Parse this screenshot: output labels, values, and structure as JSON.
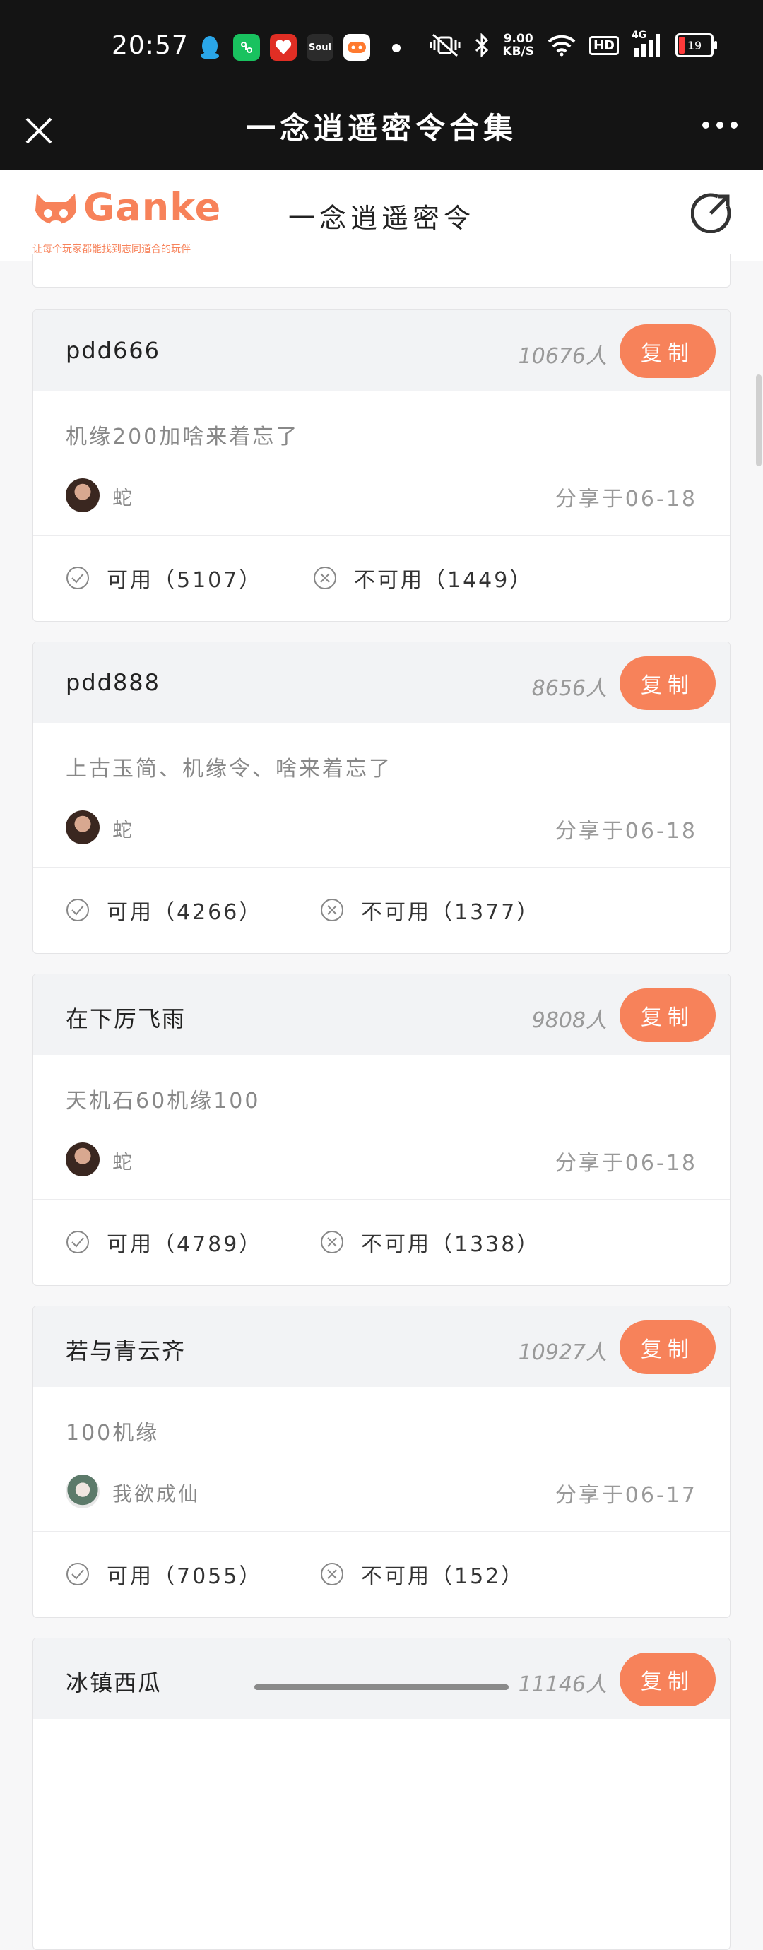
{
  "status": {
    "time": "20:57",
    "net_speed_value": "9.00",
    "net_speed_unit": "KB/S",
    "hd": "HD",
    "signal": "4G",
    "battery": "19",
    "app_icons": [
      "qq-icon",
      "wechat-mini-icon",
      "pinduoduo-icon",
      "soul-icon",
      "game-center-icon"
    ],
    "soul_label": "Soul"
  },
  "titlebar": {
    "title": "一念逍遥密令合集"
  },
  "header": {
    "logo_text": "Ganke",
    "logo_tagline": "让每个玩家都能找到志同道合的玩伴",
    "subtitle": "一念逍遥密令"
  },
  "colors": {
    "accent": "#f7825a",
    "topbar": "#141414"
  },
  "cards": [
    {
      "code": "pdd666",
      "viewers": "10676人",
      "copy_label": "复制",
      "description": "机缘200加啥来着忘了",
      "user": "蛇",
      "date": "分享于06-18",
      "available": "可用（5107）",
      "unavailable": "不可用（1449）"
    },
    {
      "code": "pdd888",
      "viewers": "8656人",
      "copy_label": "复制",
      "description": "上古玉简、机缘令、啥来着忘了",
      "user": "蛇",
      "date": "分享于06-18",
      "available": "可用（4266）",
      "unavailable": "不可用（1377）"
    },
    {
      "code": "在下厉飞雨",
      "viewers": "9808人",
      "copy_label": "复制",
      "description": "天机石60机缘100",
      "user": "蛇",
      "date": "分享于06-18",
      "available": "可用（4789）",
      "unavailable": "不可用（1338）"
    },
    {
      "code": "若与青云齐",
      "viewers": "10927人",
      "copy_label": "复制",
      "description": "100机缘",
      "user": "我欲成仙",
      "date": "分享于06-17",
      "available": "可用（7055）",
      "unavailable": "不可用（152）"
    },
    {
      "code": "冰镇西瓜",
      "viewers": "11146人",
      "copy_label": "复制"
    }
  ]
}
